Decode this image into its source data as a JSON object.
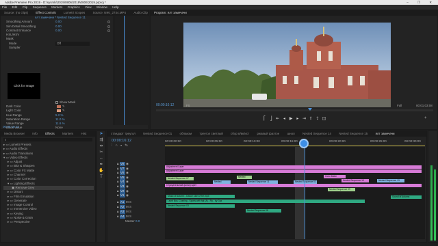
{
  "window": {
    "title": "Adobe Premiere Pro 2019 - D:\\sysmki\\2019\\0806\\2019\\0806\\2019.prproj *",
    "controls": "– ❐ ✕"
  },
  "menu": [
    "File",
    "Edit",
    "Clip",
    "Sequence",
    "Markers",
    "Graphics",
    "View",
    "Window",
    "Help"
  ],
  "top_left": {
    "tabs": [
      "Source: (no clips)",
      "Effect Controls",
      "Lumetri Scopes",
      "Source: NIKI_2744.MP4",
      "Audio Clip Mixer: ялт замечачи"
    ],
    "sequence_label": "ялт замечачи * Nested Sequence 11",
    "properties": [
      {
        "label": "Smoothing Amount",
        "value": "0.00"
      },
      {
        "label": "Sim Detail Smoothing",
        "value": "0.00"
      },
      {
        "label": "Contrast Enhance",
        "value": "0.00"
      },
      {
        "label": "HSL/HSV",
        "value": ""
      },
      {
        "label": "Mask",
        "value": ""
      },
      {
        "label": "Mode",
        "value": "Off"
      }
    ],
    "sampler": {
      "label": "Sampler",
      "image_text": "Click for Image",
      "show_mask": "Show Mask"
    },
    "colors": [
      {
        "label": "Dark Color",
        "color": "#c0725a"
      },
      {
        "label": "Light Color",
        "color": "#d99b7e"
      }
    ],
    "ranges": [
      {
        "label": "Hue Range",
        "value": "5.2 %"
      },
      {
        "label": "Saturation Range",
        "value": "11.0 %"
      },
      {
        "label": "Value Range",
        "value": "11.6 %"
      },
      {
        "label": "Black Value",
        "value": "None"
      }
    ],
    "timecode": "00:00:16:12"
  },
  "program": {
    "tab": "Program: ялт замечачи",
    "timecode": "00:00:16:12",
    "zoom": "Fit",
    "quality": "Full",
    "duration": "00:01:03:08"
  },
  "project": {
    "tabs": [
      "Media Browser",
      "Info",
      "Effects",
      "Markers",
      "Hist"
    ],
    "items": [
      "Lumetri Presets",
      "Audio Effects",
      "Audio Transitions",
      "Video Effects",
      "Adjust",
      "Blur & Sharpen",
      "Color FX Matte",
      "Channel",
      "Color Correction",
      "Lighting Effects",
      "Remove Grey",
      "Distort",
      "Film Emulation",
      "Generate",
      "Image Control",
      "Immersive Video",
      "Keying",
      "Noise & Grain",
      "Perspective"
    ]
  },
  "timeline": {
    "tabs": [
      "стандарт треугол",
      "Nested Sequence 01",
      "облаком",
      "треугол светлый",
      "сбор в/вк/ист",
      "ржавый фаэтон",
      "шнол",
      "Nested Sequence 14",
      "Nested Sequence 15",
      "ялт замечачи"
    ],
    "timecode": "00:00:16:12",
    "ruler": [
      "00:00:00:00",
      "00:00:05:00",
      "00:00:10:00",
      "00:00:15:00",
      "00:00:20:00",
      "00:00:25:00",
      "00:00:30:00"
    ],
    "tracks": [
      "V8",
      "V7",
      "V6",
      "V5",
      "V4",
      "V3",
      "V2",
      "V1",
      "A1",
      "A2",
      "A3",
      "A4",
      "Master"
    ],
    "master_value": "0.0",
    "clips": [
      {
        "label": "Adjustment Layer",
        "color": "#d77bd7"
      },
      {
        "label": "Adjustment Layer",
        "color": "#d77bd7"
      },
      {
        "label": "Nested Sequence 07",
        "color": "#9fd08c"
      },
      {
        "label": "Nested",
        "color": "#9fd08c"
      },
      {
        "label": "Color Matte",
        "color": "#d77bd7"
      },
      {
        "label": "Nested Sequence 10",
        "color": "#d77bd7"
      },
      {
        "label": "Отрицательный фильтр цвет",
        "color": "#d77bd7"
      },
      {
        "label": "Nested",
        "color": "#7fb3e0"
      },
      {
        "label": "Nested Sequence 11",
        "color": "#7fb3e0"
      },
      {
        "label": "Nested Sequence 02",
        "color": "#7fb3e0"
      },
      {
        "label": "Nested Sequence 09",
        "color": "#9fd08c"
      },
      {
        "label": "Nested Sequence 13",
        "color": "#7fb3e0"
      },
      {
        "label": "Music of Autumn - Dance Like a Fire.mp3",
        "color": "#2fa982"
      },
      {
        "label": "Level Illus. Cushing - Sports with hat (A) - Fly - by Gaz",
        "color": "#2fa982"
      },
      {
        "label": "Nested Sequence 03",
        "color": "#2fa982"
      },
      {
        "label": "Nested Sequence 08",
        "color": "#2fa982"
      },
      {
        "label": "Sound of Autumn",
        "color": "#2fa982"
      }
    ]
  }
}
